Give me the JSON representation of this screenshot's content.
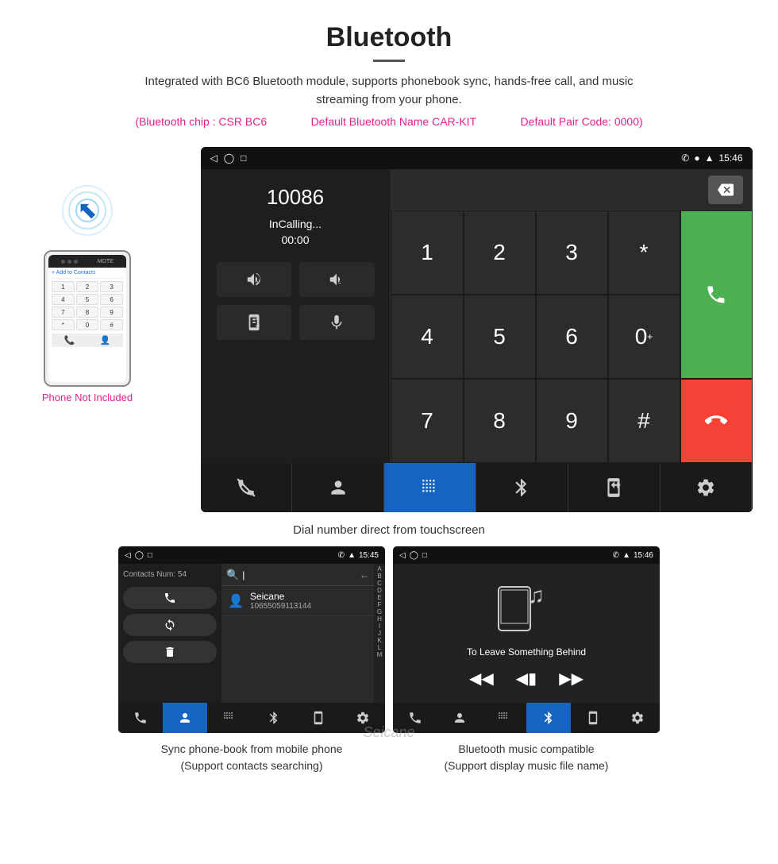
{
  "page": {
    "title": "Bluetooth",
    "description": "Integrated with BC6 Bluetooth module, supports phonebook sync, hands-free call, and music streaming from your phone.",
    "specs": {
      "chip": "(Bluetooth chip : CSR BC6",
      "name": "Default Bluetooth Name CAR-KIT",
      "pair": "Default Pair Code: 0000)"
    }
  },
  "main_screen": {
    "status_bar": {
      "time": "15:46",
      "left_icons": [
        "back-triangle",
        "circle",
        "square"
      ]
    },
    "dial": {
      "number": "10086",
      "status": "InCalling...",
      "timer": "00:00",
      "input_placeholder": ""
    },
    "keypad": [
      "1",
      "2",
      "3",
      "*",
      "4",
      "5",
      "6",
      "0+",
      "7",
      "8",
      "9",
      "#"
    ],
    "caption": "Dial number direct from touchscreen"
  },
  "phonebook_screen": {
    "status_bar": {
      "time": "15:45"
    },
    "contacts_label": "Contacts Num:",
    "contacts_count": "54",
    "contact": {
      "name": "Seicane",
      "number": "10655059113144"
    },
    "search_placeholder": "|",
    "alpha_letters": [
      "A",
      "B",
      "C",
      "D",
      "E",
      "F",
      "G",
      "H",
      "I",
      "J",
      "K",
      "L",
      "M"
    ],
    "caption_line1": "Sync phone-book from mobile phone",
    "caption_line2": "(Support contacts searching)"
  },
  "music_screen": {
    "status_bar": {
      "time": "15:46"
    },
    "song_name": "To Leave Something Behind",
    "caption_line1": "Bluetooth music compatible",
    "caption_line2": "(Support display music file name)"
  },
  "phone_side": {
    "not_included": "Phone Not Included"
  },
  "nav_icons": {
    "phone": "📞",
    "contacts": "👤",
    "keypad": "⌨",
    "bluetooth": "⚡",
    "transfer": "📲",
    "settings": "⚙"
  },
  "watermark": "Seicane"
}
